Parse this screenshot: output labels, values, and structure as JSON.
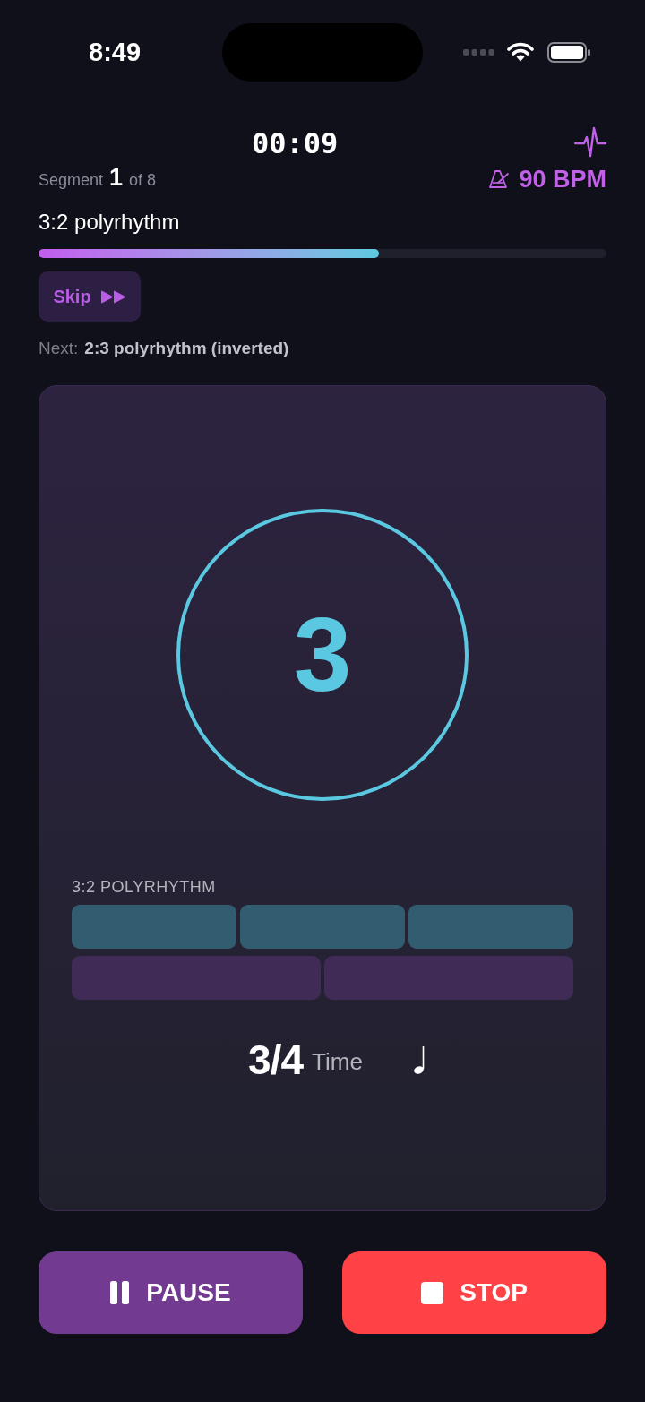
{
  "status_bar": {
    "time": "8:49"
  },
  "header": {
    "elapsed": "00:09",
    "segment_label": "Segment",
    "segment_number": "1",
    "segment_total": "of 8",
    "tempo": "90 BPM"
  },
  "segment": {
    "title": "3:2 polyrhythm",
    "progress": {
      "level": 0.6
    },
    "skip_button": "Skip",
    "next_label": "Next:",
    "next_title": "2:3 polyrhythm (inverted)"
  },
  "display": {
    "beat": "3",
    "pattern_title": "3:2 POLYRHYTHM",
    "lanes": [
      {
        "color": "#325d70",
        "beats": [
          {
            "kind": "beat"
          },
          {
            "kind": "beat"
          },
          {
            "kind": "beat"
          }
        ]
      },
      {
        "color": "#3f2b55",
        "beats": [
          {
            "kind": "beat"
          },
          {
            "kind": "beat"
          }
        ]
      }
    ],
    "time_signature": "3/4",
    "time_label": "Time"
  },
  "controls": [
    {
      "kind": "pause",
      "label": "PAUSE"
    },
    {
      "kind": "stop",
      "label": "STOP"
    }
  ]
}
